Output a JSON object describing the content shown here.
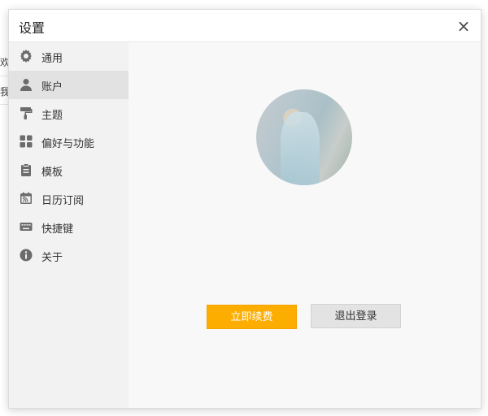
{
  "background": {
    "fragment_1": "欢",
    "fragment_2": "我"
  },
  "dialog": {
    "title": "设置",
    "close_label": "×"
  },
  "sidebar": {
    "items": [
      {
        "label": "通用",
        "icon": "gear-icon"
      },
      {
        "label": "账户",
        "icon": "user-icon",
        "active": true
      },
      {
        "label": "主题",
        "icon": "paint-roller-icon"
      },
      {
        "label": "偏好与功能",
        "icon": "grid-icon"
      },
      {
        "label": "模板",
        "icon": "clipboard-icon"
      },
      {
        "label": "日历订阅",
        "icon": "calendar-rss-icon"
      },
      {
        "label": "快捷键",
        "icon": "keyboard-icon"
      },
      {
        "label": "关于",
        "icon": "info-icon"
      }
    ]
  },
  "account": {
    "renew_button": "立即续费",
    "logout_button": "退出登录"
  },
  "colors": {
    "accent": "#fdad00",
    "sidebar_bg": "#f2f2f2",
    "active_item_bg": "#e2e2e2"
  }
}
